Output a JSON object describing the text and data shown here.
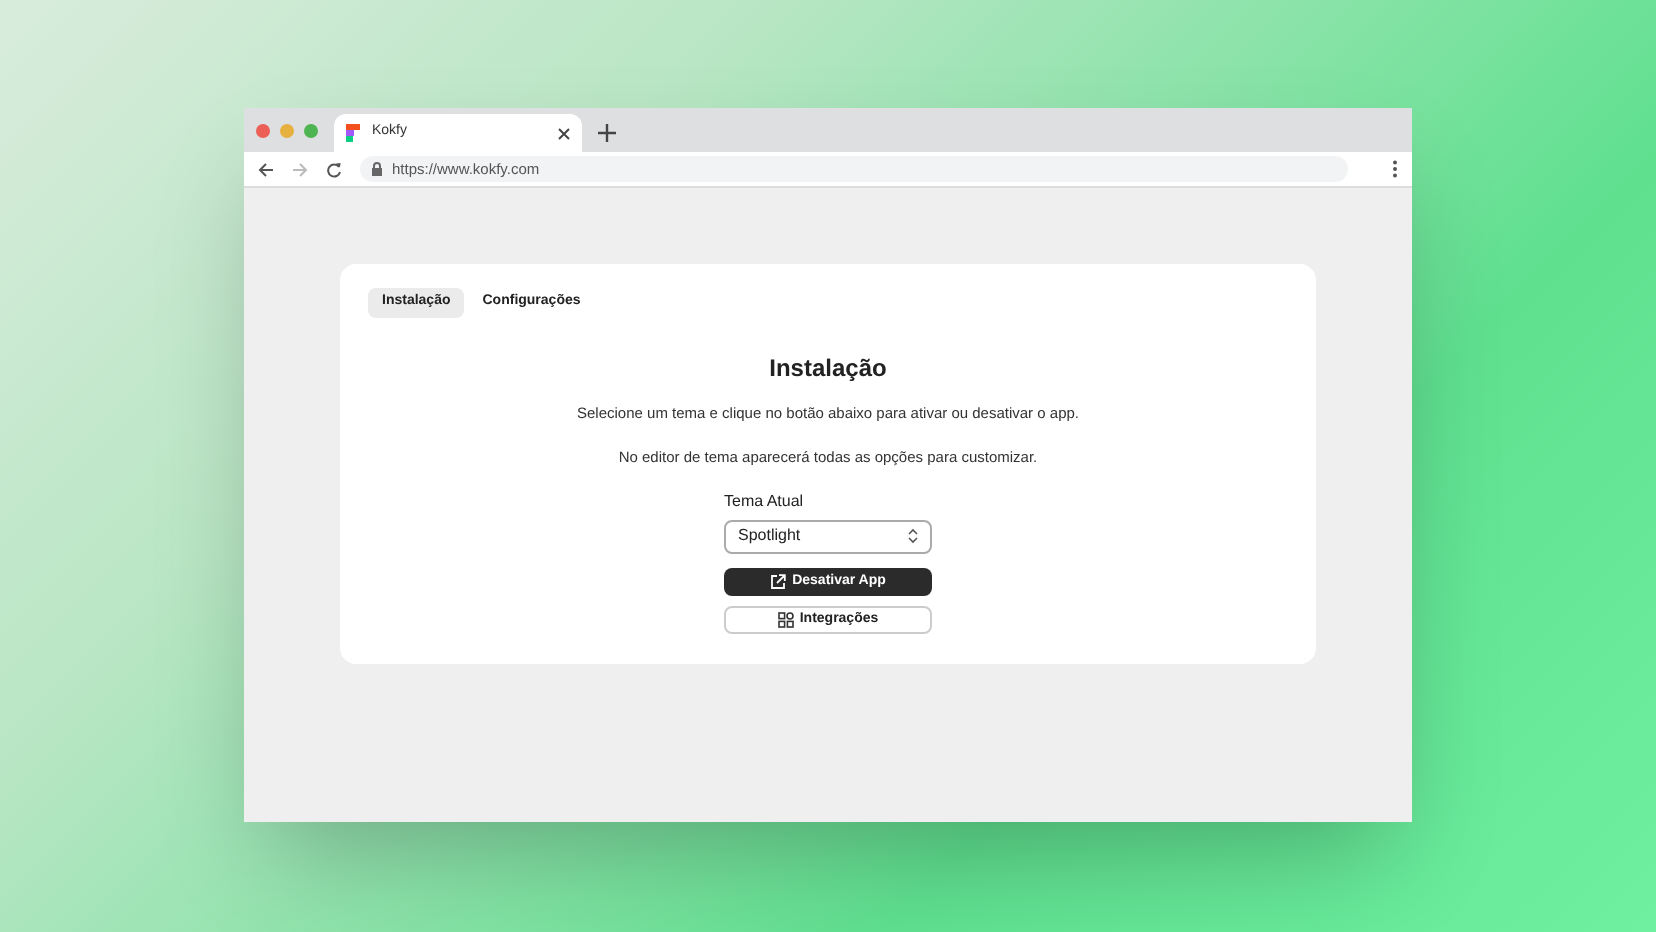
{
  "browser": {
    "tab_title": "Kokfy",
    "url": "https://www.kokfy.com"
  },
  "tabs": [
    {
      "label": "Instalação",
      "selected": true
    },
    {
      "label": "Configurações",
      "selected": false
    }
  ],
  "heading": "Instalação",
  "paragraphs": [
    "Selecione um tema e clique no botão abaixo para ativar ou desativar o app.",
    "No editor de tema aparecerá todas as opções para customizar."
  ],
  "theme_select": {
    "label": "Tema Atual",
    "value": "Spotlight"
  },
  "buttons": [
    {
      "label": "Desativar App",
      "kind": "primary"
    },
    {
      "label": "Integrações",
      "kind": "secondary"
    }
  ]
}
